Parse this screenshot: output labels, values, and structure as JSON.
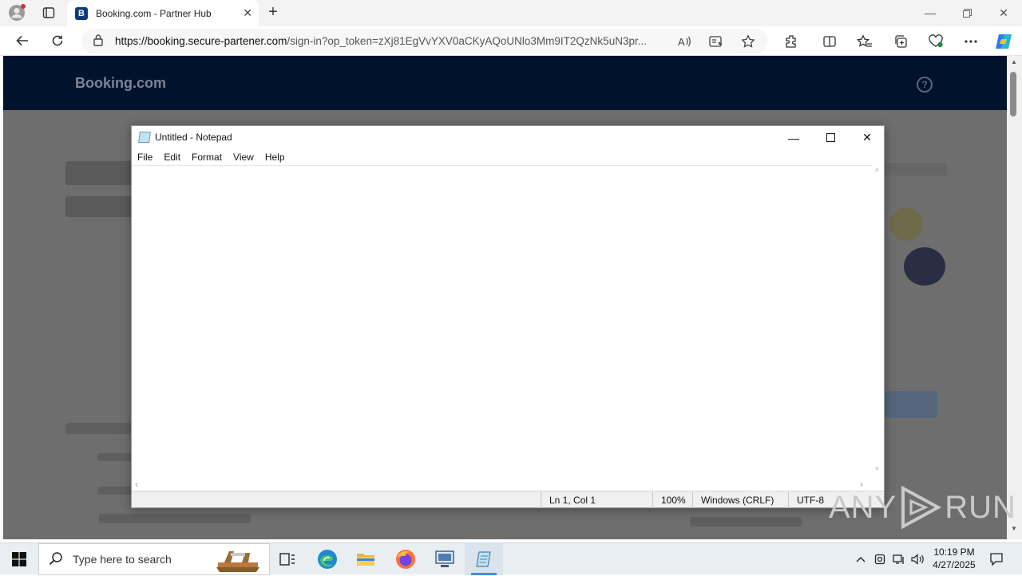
{
  "browser": {
    "tab": {
      "favicon_letter": "B",
      "title": "Booking.com - Partner Hub"
    },
    "address": {
      "url_host": "https://booking.secure-partener.com",
      "url_rest": "/sign-in?op_token=zXj81EgVvYXV0aCKyAQoUNlo3Mm9IT2QzNk5uN3pr..."
    },
    "icons": [
      "profile-icon",
      "tab-actions-icon",
      "close-icon",
      "new-tab-icon",
      "minimize-icon",
      "restore-icon",
      "back-icon",
      "refresh-icon",
      "lock-icon",
      "read-aloud-icon",
      "immersive-reader-icon",
      "favorite-star-icon",
      "extensions-icon",
      "split-screen-icon",
      "favorites-icon",
      "collections-icon",
      "browser-essentials-icon",
      "more-icon",
      "copilot-icon"
    ]
  },
  "page": {
    "logo": "Booking.com",
    "help_glyph": "?"
  },
  "notepad": {
    "title": "Untitled - Notepad",
    "menu": [
      "File",
      "Edit",
      "Format",
      "View",
      "Help"
    ],
    "content": "",
    "status": {
      "position": "Ln 1, Col 1",
      "zoom": "100%",
      "line_ending": "Windows (CRLF)",
      "encoding": "UTF-8"
    }
  },
  "watermark": {
    "left": "ANY",
    "right": "RUN"
  },
  "taskbar": {
    "search_placeholder": "Type here to search",
    "apps": [
      "task-view-icon",
      "edge-icon",
      "file-explorer-icon",
      "firefox-icon",
      "network-app-icon",
      "notepad-icon"
    ],
    "clock": {
      "time": "10:19 PM",
      "date": "4/27/2025"
    }
  },
  "colors": {
    "booking_header": "#00122c",
    "overlay": "#6e6e6e",
    "taskbar": "#e9eef3",
    "accent": "#4a90d9"
  }
}
